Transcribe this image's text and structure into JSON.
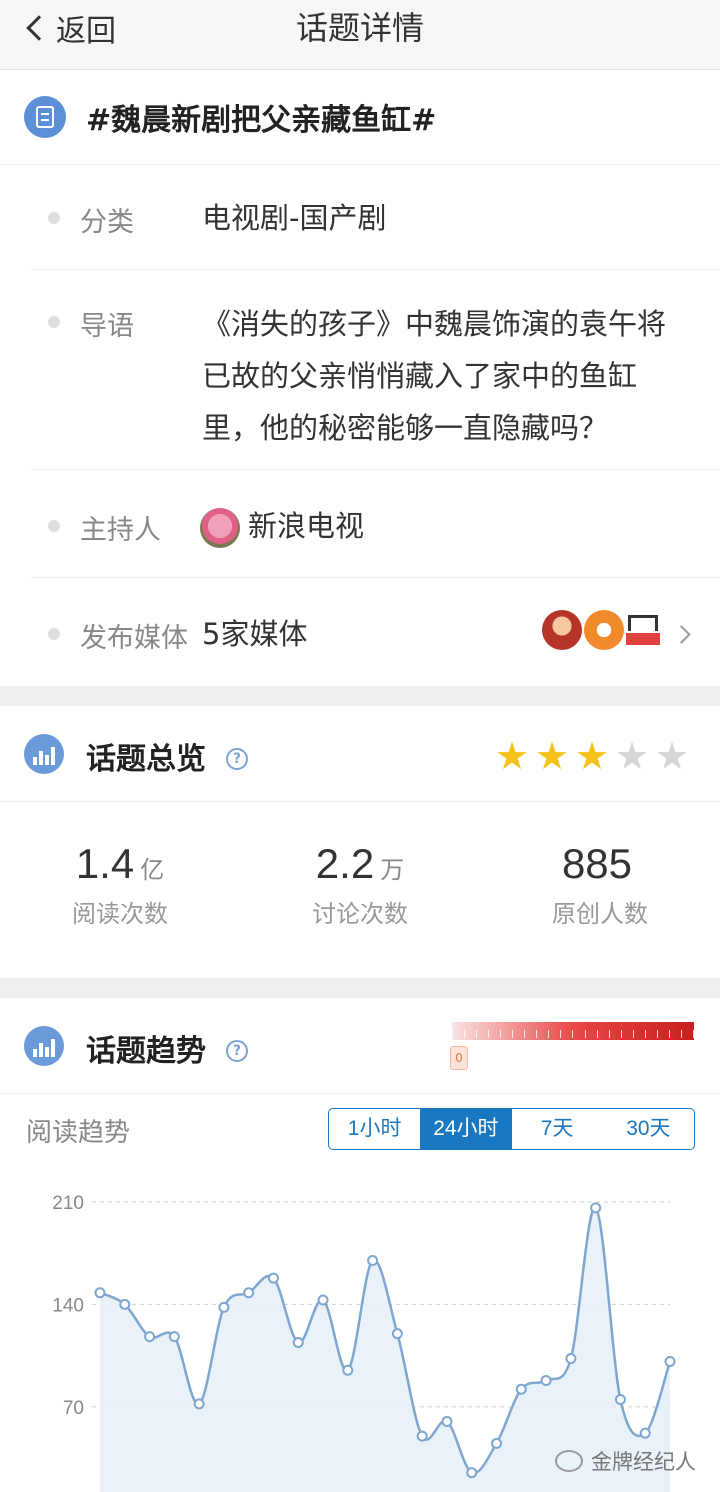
{
  "nav": {
    "back_label": "返回",
    "title": "话题详情"
  },
  "topic": {
    "title": "#魏晨新剧把父亲藏鱼缸#"
  },
  "info": {
    "category_label": "分类",
    "category_value": "电视剧-国产剧",
    "intro_label": "导语",
    "intro_value": "《消失的孩子》中魏晨饰演的袁午将已故的父亲悄悄藏入了家中的鱼缸里，他的秘密能够一直隐藏吗？",
    "host_label": "主持人",
    "host_value": "新浪电视",
    "media_label": "发布媒体",
    "media_value": "5家媒体"
  },
  "overview": {
    "title": "话题总览",
    "help_glyph": "?",
    "rating": 3,
    "rating_max": 5,
    "stats": [
      {
        "num": "1.4",
        "unit": "亿",
        "label": "阅读次数"
      },
      {
        "num": "2.2",
        "unit": "万",
        "label": "讨论次数"
      },
      {
        "num": "885",
        "unit": "",
        "label": "原创人数"
      }
    ]
  },
  "trend": {
    "title": "话题趋势",
    "help_glyph": "?",
    "heat_marker": "0",
    "sub_label": "阅读趋势",
    "tabs": [
      {
        "label": "1小时",
        "active": false
      },
      {
        "label": "24小时",
        "active": true
      },
      {
        "label": "7天",
        "active": false
      },
      {
        "label": "30天",
        "active": false
      }
    ]
  },
  "chart_data": {
    "type": "line",
    "y_ticks": [
      "210",
      "140",
      "70"
    ],
    "ylim": [
      20,
      210
    ],
    "grid": true,
    "series": [
      {
        "values": [
          148,
          140,
          118,
          118,
          72,
          138,
          148,
          158,
          114,
          143,
          95,
          170,
          120,
          50,
          60,
          25,
          45,
          82,
          88,
          103,
          206,
          75,
          52,
          101
        ]
      }
    ],
    "colors": {
      "line": "#7ea6cf",
      "fill": "#e3edf8",
      "grid": "#cfcfcf"
    }
  },
  "watermark": {
    "text": "金牌经纪人"
  }
}
